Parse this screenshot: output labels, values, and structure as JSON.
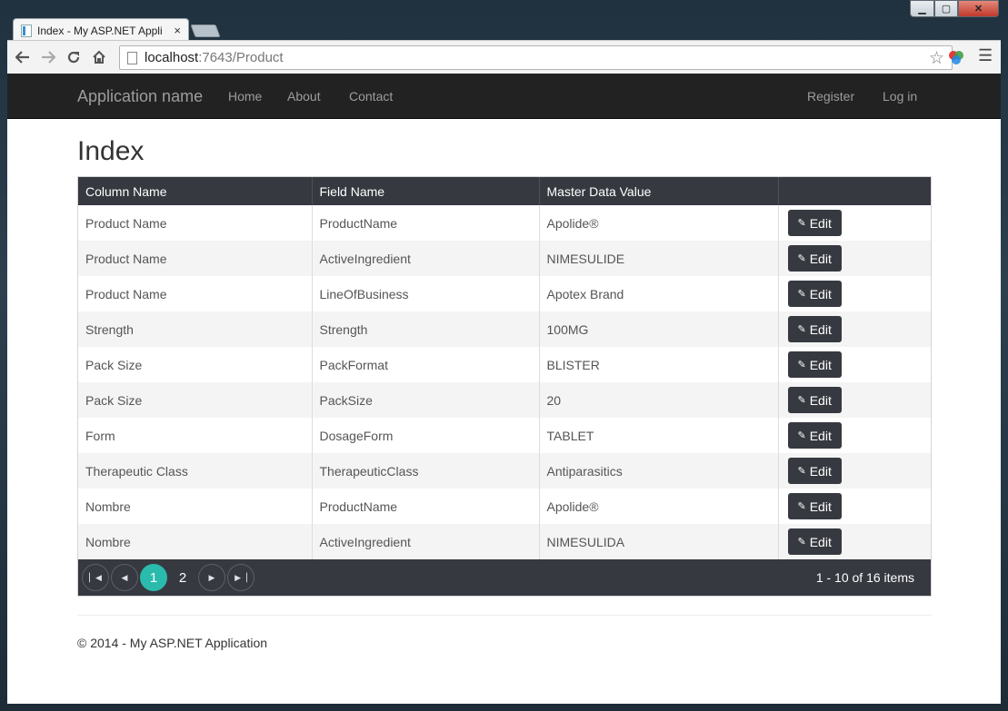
{
  "browser": {
    "tab_title": "Index - My ASP.NET Appli",
    "tab_close": "×",
    "url_host": "localhost",
    "url_path": ":7643/Product"
  },
  "icons": {
    "back": "back-arrow-icon",
    "forward": "forward-arrow-icon",
    "reload": "reload-icon",
    "home": "home-icon",
    "star": "bookmark-star-icon",
    "menu": "hamburger-menu-icon",
    "edit": "pencil-icon",
    "first": "first-page-icon",
    "prev": "prev-page-icon",
    "next": "next-page-icon",
    "last": "last-page-icon"
  },
  "colors": {
    "navbar_bg": "#222222",
    "grid_header_bg": "#363940",
    "pager_active": "#2bbbad"
  },
  "navbar": {
    "brand": "Application name",
    "links": [
      "Home",
      "About",
      "Contact"
    ],
    "right_links": [
      "Register",
      "Log in"
    ]
  },
  "main": {
    "title": "Index",
    "columns": [
      "Column Name",
      "Field Name",
      "Master Data Value",
      ""
    ],
    "edit_label": "Edit",
    "rows": [
      [
        "Product Name",
        "ProductName",
        "Apolide®"
      ],
      [
        "Product Name",
        "ActiveIngredient",
        "NIMESULIDE"
      ],
      [
        "Product Name",
        "LineOfBusiness",
        "Apotex Brand"
      ],
      [
        "Strength",
        "Strength",
        "100MG"
      ],
      [
        "Pack Size",
        "PackFormat",
        "BLISTER"
      ],
      [
        "Pack Size",
        "PackSize",
        "20"
      ],
      [
        "Form",
        "DosageForm",
        "TABLET"
      ],
      [
        "Therapeutic Class",
        "TherapeuticClass",
        "Antiparasitics"
      ],
      [
        "Nombre",
        "ProductName",
        "Apolide®"
      ],
      [
        "Nombre",
        "ActiveIngredient",
        "NIMESULIDA"
      ]
    ],
    "pager": {
      "pages": [
        "1",
        "2"
      ],
      "current_page": "1",
      "info": "1 - 10 of 16 items"
    }
  },
  "footer": {
    "text": "© 2014 - My ASP.NET Application"
  }
}
